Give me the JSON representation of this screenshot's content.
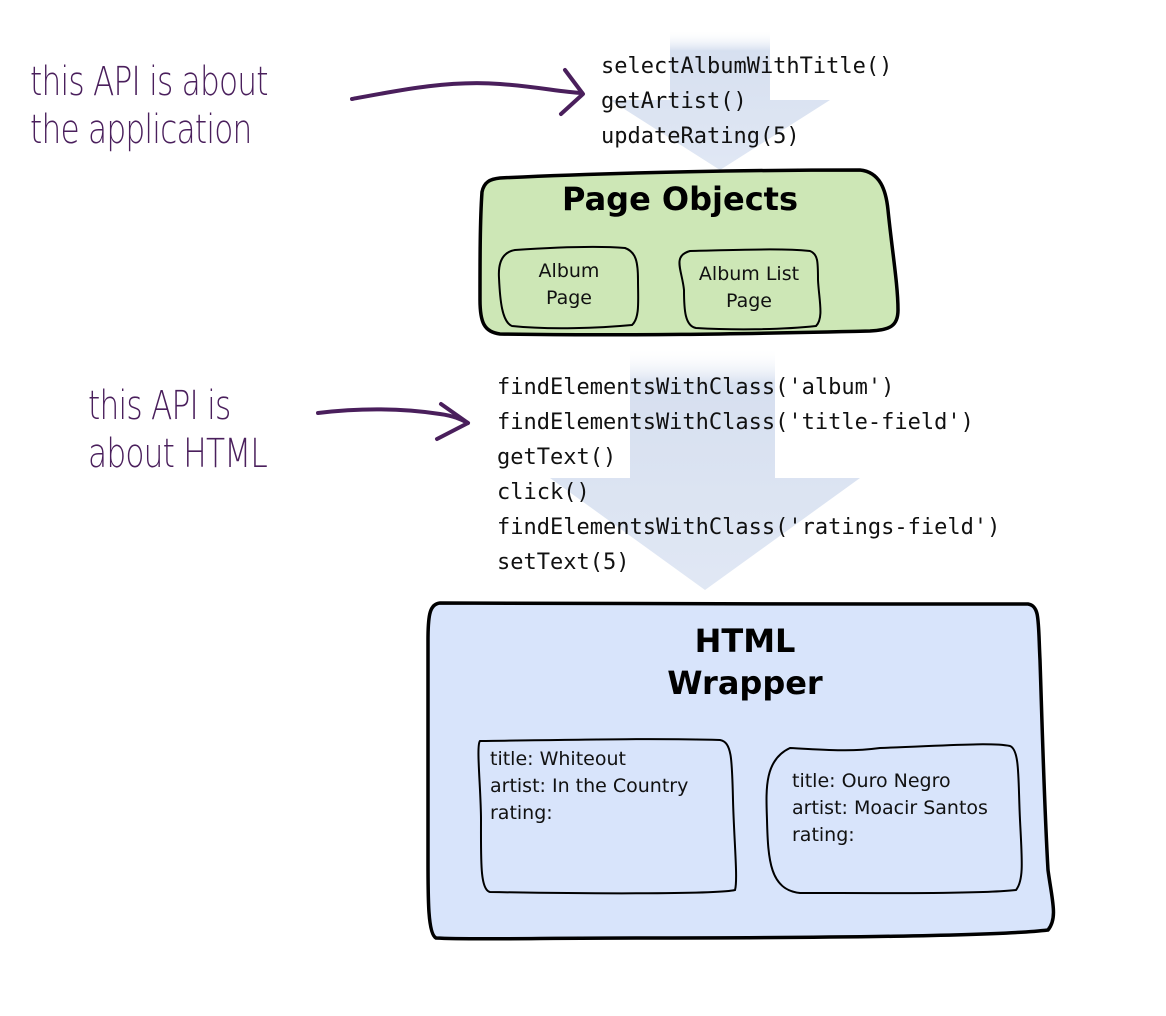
{
  "colors": {
    "annotation": "#4a1f5c",
    "page_objects_fill": "#cde7b6",
    "html_wrapper_fill": "#d8e4fb",
    "flow_arrow": "#c8d5ec",
    "outline": "#000000"
  },
  "annotations": [
    {
      "lines": [
        "this API is about",
        "the application"
      ],
      "arrow_icon": "hand-drawn-arrow-right"
    },
    {
      "lines": [
        "this API is",
        "about HTML"
      ],
      "arrow_icon": "hand-drawn-arrow-right"
    }
  ],
  "app_api": {
    "calls": [
      "selectAlbumWithTitle()",
      "getArtist()",
      "updateRating(5)"
    ]
  },
  "page_objects": {
    "title": "Page Objects",
    "children": [
      {
        "lines": [
          "Album",
          "Page"
        ]
      },
      {
        "lines": [
          "Album List",
          "Page"
        ]
      }
    ]
  },
  "html_api": {
    "calls": [
      "findElementsWithClass('album')",
      "findElementsWithClass('title-field')",
      "getText()",
      "click()",
      "findElementsWithClass('ratings-field')",
      "setText(5)"
    ]
  },
  "html_wrapper": {
    "title_lines": [
      "HTML",
      "Wrapper"
    ],
    "albums": [
      {
        "title": "title: Whiteout",
        "artist": "artist: In the Country",
        "rating": "rating:"
      },
      {
        "title": "title: Ouro Negro",
        "artist": "artist: Moacir Santos",
        "rating": "rating:"
      }
    ]
  }
}
